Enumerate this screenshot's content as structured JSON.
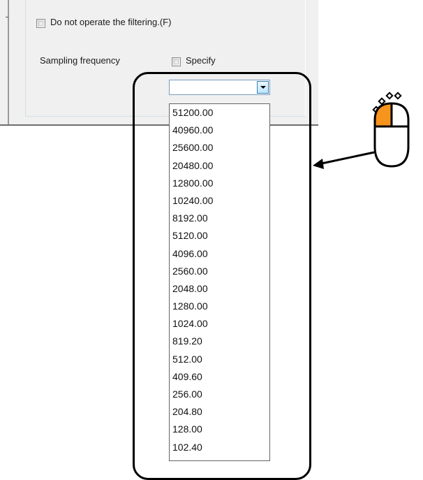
{
  "options": {
    "no_filter_label": "Do not operate the filtering.(F)",
    "sampling_frequency_label": "Sampling frequency",
    "specify_label": "Specify"
  },
  "combo": {
    "value": ""
  },
  "dropdown": {
    "items": [
      "51200.00",
      "40960.00",
      "25600.00",
      "20480.00",
      "12800.00",
      "10240.00",
      "8192.00",
      "5120.00",
      "4096.00",
      "2560.00",
      "2048.00",
      "1280.00",
      "1024.00",
      "819.20",
      "512.00",
      "409.60",
      "256.00",
      "204.80",
      "128.00",
      "102.40"
    ]
  },
  "colors": {
    "mouse_button_highlight": "#f7941d",
    "combo_button": "#bde6fd"
  },
  "icons": {
    "mouse": "mouse-click-icon",
    "arrow": "pointer-arrow"
  }
}
